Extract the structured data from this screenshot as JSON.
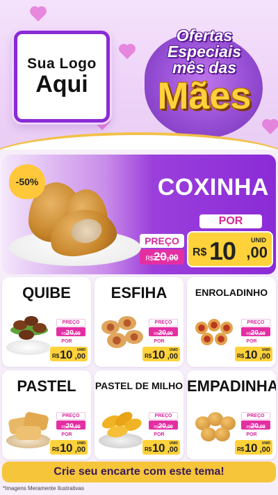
{
  "header": {
    "logo": {
      "line1": "Sua Logo",
      "line2": "Aqui"
    },
    "title": {
      "line1": "Ofertas",
      "line2": "Especiais",
      "line3": "mês das",
      "big": "Mães"
    }
  },
  "hero": {
    "badge": "-50%",
    "name": "COXINHA",
    "preco_label": "PREÇO",
    "old_price": {
      "currency": "R$",
      "integer": "20",
      "decimal": ",00"
    },
    "por_label": "POR",
    "new_price": {
      "unit": "UNID",
      "currency": "R$",
      "integer": "10",
      "decimal": ",00"
    }
  },
  "products": [
    {
      "name": "QUIBE",
      "small": false,
      "preco_label": "PREÇO",
      "old_currency": "R$",
      "old_integer": "20",
      "old_decimal": ",00",
      "por_label": "POR",
      "unit": "UNID",
      "currency": "R$",
      "integer": "10",
      "decimal": ",00"
    },
    {
      "name": "ESFIHA",
      "small": false,
      "preco_label": "PREÇO",
      "old_currency": "R$",
      "old_integer": "20",
      "old_decimal": ",00",
      "por_label": "POR",
      "unit": "UNID",
      "currency": "R$",
      "integer": "10",
      "decimal": ",00"
    },
    {
      "name": "ENROLADINHO",
      "small": true,
      "preco_label": "PREÇO",
      "old_currency": "R$",
      "old_integer": "20",
      "old_decimal": ",00",
      "por_label": "POR",
      "unit": "UNID",
      "currency": "R$",
      "integer": "10",
      "decimal": ",00"
    },
    {
      "name": "PASTEL",
      "small": false,
      "preco_label": "PREÇO",
      "old_currency": "R$",
      "old_integer": "20",
      "old_decimal": ",00",
      "por_label": "POR",
      "unit": "UNID",
      "currency": "R$",
      "integer": "10",
      "decimal": ",00"
    },
    {
      "name": "PASTEL DE MILHO",
      "small": true,
      "preco_label": "PREÇO",
      "old_currency": "R$",
      "old_integer": "20",
      "old_decimal": ",00",
      "por_label": "POR",
      "unit": "UNID",
      "currency": "R$",
      "integer": "10",
      "decimal": ",00"
    },
    {
      "name": "EMPADINHA",
      "small": false,
      "preco_label": "PREÇO",
      "old_currency": "R$",
      "old_integer": "20",
      "old_decimal": ",00",
      "por_label": "POR",
      "unit": "UNID",
      "currency": "R$",
      "integer": "10",
      "decimal": ",00"
    }
  ],
  "footer": {
    "cta": "Crie seu encarte com este tema!",
    "disclaimer": "*Imagens Meramente Ilustrativas"
  },
  "colors": {
    "purple": "#8a2bd6",
    "pink": "#e42fa3",
    "yellow": "#ffd23b",
    "gold": "#f6c53a"
  }
}
